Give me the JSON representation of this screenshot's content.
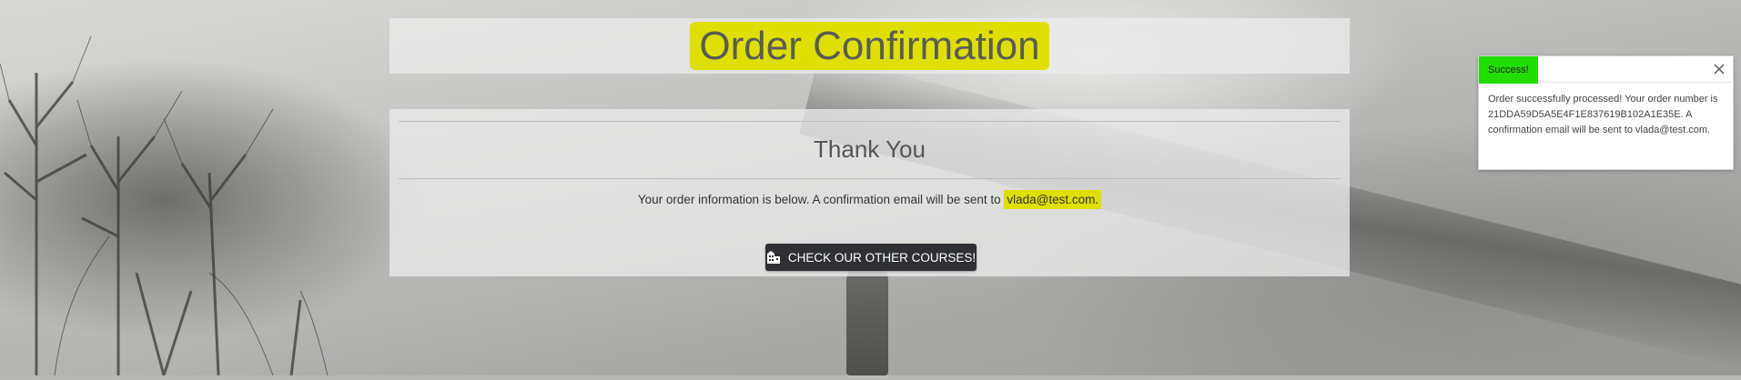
{
  "header": {
    "title": "Order Confirmation"
  },
  "card": {
    "heading": "Thank You",
    "info_prefix": "Your order information is below. A confirmation email will be sent to ",
    "email": "vlada@test.com.",
    "cta_label": "CHECK OUR OTHER COURSES!",
    "cta_icon": "building-icon"
  },
  "toast": {
    "title": "Success!",
    "message": "Order successfully processed! Your order number is 21DDA59D5A5E4F1E837619B102A1E35E. A confirmation email will be sent to vlada@test.com.",
    "close_icon": "close-icon"
  },
  "colors": {
    "highlight": "#dfe000",
    "success": "#22dd00",
    "button_bg": "#2e3034"
  }
}
